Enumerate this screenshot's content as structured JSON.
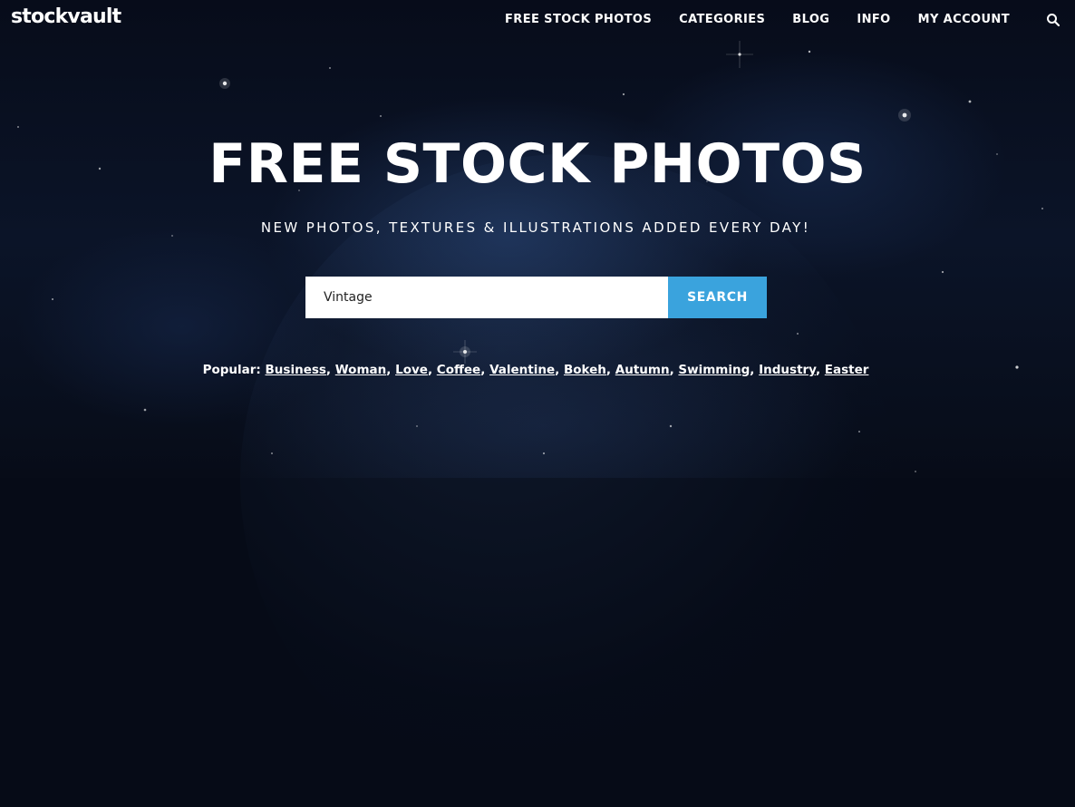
{
  "header": {
    "logo": "stockvault",
    "nav": [
      {
        "label": "FREE STOCK PHOTOS"
      },
      {
        "label": "CATEGORIES"
      },
      {
        "label": "BLOG"
      },
      {
        "label": "INFO"
      },
      {
        "label": "MY ACCOUNT"
      }
    ],
    "search_icon": "search-icon"
  },
  "hero": {
    "title": "FREE STOCK PHOTOS",
    "subtitle": "NEW PHOTOS, TEXTURES & ILLUSTRATIONS ADDED EVERY DAY!",
    "search": {
      "value": "Vintage",
      "button_label": "SEARCH"
    },
    "popular": {
      "label": "Popular:",
      "tags": [
        "Business",
        "Woman",
        "Love",
        "Coffee",
        "Valentine",
        "Bokeh",
        "Autumn",
        "Swimming",
        "Industry",
        "Easter"
      ]
    }
  },
  "colors": {
    "accent": "#3aa3dd",
    "background": "#060b17",
    "text": "#ffffff"
  }
}
